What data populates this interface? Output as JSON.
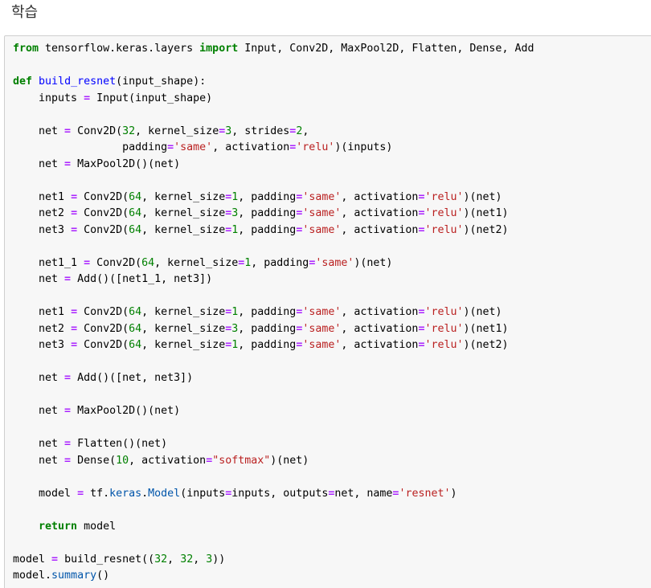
{
  "heading": "학습",
  "colors": {
    "keyword": "#008000",
    "function_name": "#0000ff",
    "operator": "#aa22ff",
    "number": "#008000",
    "string": "#ba2121",
    "attribute": "#0055aa",
    "cell_background": "#f7f7f7",
    "cell_border": "#cfcfcf"
  },
  "code_lines": [
    [
      [
        "kw",
        "from"
      ],
      [
        "plain",
        " tensorflow.keras.layers "
      ],
      [
        "kw",
        "import"
      ],
      [
        "plain",
        " Input, Conv2D, MaxPool2D, Flatten, Dense, Add"
      ]
    ],
    [],
    [
      [
        "kw",
        "def"
      ],
      [
        "plain",
        " "
      ],
      [
        "fn",
        "build_resnet"
      ],
      [
        "plain",
        "(input_shape):"
      ]
    ],
    [
      [
        "plain",
        "    inputs "
      ],
      [
        "op",
        "="
      ],
      [
        "plain",
        " Input(input_shape)"
      ]
    ],
    [],
    [
      [
        "plain",
        "    net "
      ],
      [
        "op",
        "="
      ],
      [
        "plain",
        " Conv2D("
      ],
      [
        "num",
        "32"
      ],
      [
        "plain",
        ", kernel_size"
      ],
      [
        "op",
        "="
      ],
      [
        "num",
        "3"
      ],
      [
        "plain",
        ", strides"
      ],
      [
        "op",
        "="
      ],
      [
        "num",
        "2"
      ],
      [
        "plain",
        ","
      ]
    ],
    [
      [
        "plain",
        "                 padding"
      ],
      [
        "op",
        "="
      ],
      [
        "str",
        "'same'"
      ],
      [
        "plain",
        ", activation"
      ],
      [
        "op",
        "="
      ],
      [
        "str",
        "'relu'"
      ],
      [
        "plain",
        ")(inputs)"
      ]
    ],
    [
      [
        "plain",
        "    net "
      ],
      [
        "op",
        "="
      ],
      [
        "plain",
        " MaxPool2D()(net)"
      ]
    ],
    [],
    [
      [
        "plain",
        "    net1 "
      ],
      [
        "op",
        "="
      ],
      [
        "plain",
        " Conv2D("
      ],
      [
        "num",
        "64"
      ],
      [
        "plain",
        ", kernel_size"
      ],
      [
        "op",
        "="
      ],
      [
        "num",
        "1"
      ],
      [
        "plain",
        ", padding"
      ],
      [
        "op",
        "="
      ],
      [
        "str",
        "'same'"
      ],
      [
        "plain",
        ", activation"
      ],
      [
        "op",
        "="
      ],
      [
        "str",
        "'relu'"
      ],
      [
        "plain",
        ")(net)"
      ]
    ],
    [
      [
        "plain",
        "    net2 "
      ],
      [
        "op",
        "="
      ],
      [
        "plain",
        " Conv2D("
      ],
      [
        "num",
        "64"
      ],
      [
        "plain",
        ", kernel_size"
      ],
      [
        "op",
        "="
      ],
      [
        "num",
        "3"
      ],
      [
        "plain",
        ", padding"
      ],
      [
        "op",
        "="
      ],
      [
        "str",
        "'same'"
      ],
      [
        "plain",
        ", activation"
      ],
      [
        "op",
        "="
      ],
      [
        "str",
        "'relu'"
      ],
      [
        "plain",
        ")(net1)"
      ]
    ],
    [
      [
        "plain",
        "    net3 "
      ],
      [
        "op",
        "="
      ],
      [
        "plain",
        " Conv2D("
      ],
      [
        "num",
        "64"
      ],
      [
        "plain",
        ", kernel_size"
      ],
      [
        "op",
        "="
      ],
      [
        "num",
        "1"
      ],
      [
        "plain",
        ", padding"
      ],
      [
        "op",
        "="
      ],
      [
        "str",
        "'same'"
      ],
      [
        "plain",
        ", activation"
      ],
      [
        "op",
        "="
      ],
      [
        "str",
        "'relu'"
      ],
      [
        "plain",
        ")(net2)"
      ]
    ],
    [],
    [
      [
        "plain",
        "    net1_1 "
      ],
      [
        "op",
        "="
      ],
      [
        "plain",
        " Conv2D("
      ],
      [
        "num",
        "64"
      ],
      [
        "plain",
        ", kernel_size"
      ],
      [
        "op",
        "="
      ],
      [
        "num",
        "1"
      ],
      [
        "plain",
        ", padding"
      ],
      [
        "op",
        "="
      ],
      [
        "str",
        "'same'"
      ],
      [
        "plain",
        ")(net)"
      ]
    ],
    [
      [
        "plain",
        "    net "
      ],
      [
        "op",
        "="
      ],
      [
        "plain",
        " Add()([net1_1, net3])"
      ]
    ],
    [],
    [
      [
        "plain",
        "    net1 "
      ],
      [
        "op",
        "="
      ],
      [
        "plain",
        " Conv2D("
      ],
      [
        "num",
        "64"
      ],
      [
        "plain",
        ", kernel_size"
      ],
      [
        "op",
        "="
      ],
      [
        "num",
        "1"
      ],
      [
        "plain",
        ", padding"
      ],
      [
        "op",
        "="
      ],
      [
        "str",
        "'same'"
      ],
      [
        "plain",
        ", activation"
      ],
      [
        "op",
        "="
      ],
      [
        "str",
        "'relu'"
      ],
      [
        "plain",
        ")(net)"
      ]
    ],
    [
      [
        "plain",
        "    net2 "
      ],
      [
        "op",
        "="
      ],
      [
        "plain",
        " Conv2D("
      ],
      [
        "num",
        "64"
      ],
      [
        "plain",
        ", kernel_size"
      ],
      [
        "op",
        "="
      ],
      [
        "num",
        "3"
      ],
      [
        "plain",
        ", padding"
      ],
      [
        "op",
        "="
      ],
      [
        "str",
        "'same'"
      ],
      [
        "plain",
        ", activation"
      ],
      [
        "op",
        "="
      ],
      [
        "str",
        "'relu'"
      ],
      [
        "plain",
        ")(net1)"
      ]
    ],
    [
      [
        "plain",
        "    net3 "
      ],
      [
        "op",
        "="
      ],
      [
        "plain",
        " Conv2D("
      ],
      [
        "num",
        "64"
      ],
      [
        "plain",
        ", kernel_size"
      ],
      [
        "op",
        "="
      ],
      [
        "num",
        "1"
      ],
      [
        "plain",
        ", padding"
      ],
      [
        "op",
        "="
      ],
      [
        "str",
        "'same'"
      ],
      [
        "plain",
        ", activation"
      ],
      [
        "op",
        "="
      ],
      [
        "str",
        "'relu'"
      ],
      [
        "plain",
        ")(net2)"
      ]
    ],
    [],
    [
      [
        "plain",
        "    net "
      ],
      [
        "op",
        "="
      ],
      [
        "plain",
        " Add()([net, net3])"
      ]
    ],
    [],
    [
      [
        "plain",
        "    net "
      ],
      [
        "op",
        "="
      ],
      [
        "plain",
        " MaxPool2D()(net)"
      ]
    ],
    [],
    [
      [
        "plain",
        "    net "
      ],
      [
        "op",
        "="
      ],
      [
        "plain",
        " Flatten()(net)"
      ]
    ],
    [
      [
        "plain",
        "    net "
      ],
      [
        "op",
        "="
      ],
      [
        "plain",
        " Dense("
      ],
      [
        "num",
        "10"
      ],
      [
        "plain",
        ", activation"
      ],
      [
        "op",
        "="
      ],
      [
        "str",
        "\"softmax\""
      ],
      [
        "plain",
        ")(net)"
      ]
    ],
    [],
    [
      [
        "plain",
        "    model "
      ],
      [
        "op",
        "="
      ],
      [
        "plain",
        " tf."
      ],
      [
        "attr",
        "keras"
      ],
      [
        "plain",
        "."
      ],
      [
        "attr",
        "Model"
      ],
      [
        "plain",
        "(inputs"
      ],
      [
        "op",
        "="
      ],
      [
        "plain",
        "inputs, outputs"
      ],
      [
        "op",
        "="
      ],
      [
        "plain",
        "net, name"
      ],
      [
        "op",
        "="
      ],
      [
        "str",
        "'resnet'"
      ],
      [
        "plain",
        ")"
      ]
    ],
    [],
    [
      [
        "plain",
        "    "
      ],
      [
        "kw",
        "return"
      ],
      [
        "plain",
        " model"
      ]
    ],
    [],
    [
      [
        "plain",
        "model "
      ],
      [
        "op",
        "="
      ],
      [
        "plain",
        " build_resnet(("
      ],
      [
        "num",
        "32"
      ],
      [
        "plain",
        ", "
      ],
      [
        "num",
        "32"
      ],
      [
        "plain",
        ", "
      ],
      [
        "num",
        "3"
      ],
      [
        "plain",
        "))"
      ]
    ],
    [
      [
        "plain",
        "model."
      ],
      [
        "attr",
        "summary"
      ],
      [
        "plain",
        "()"
      ]
    ]
  ]
}
